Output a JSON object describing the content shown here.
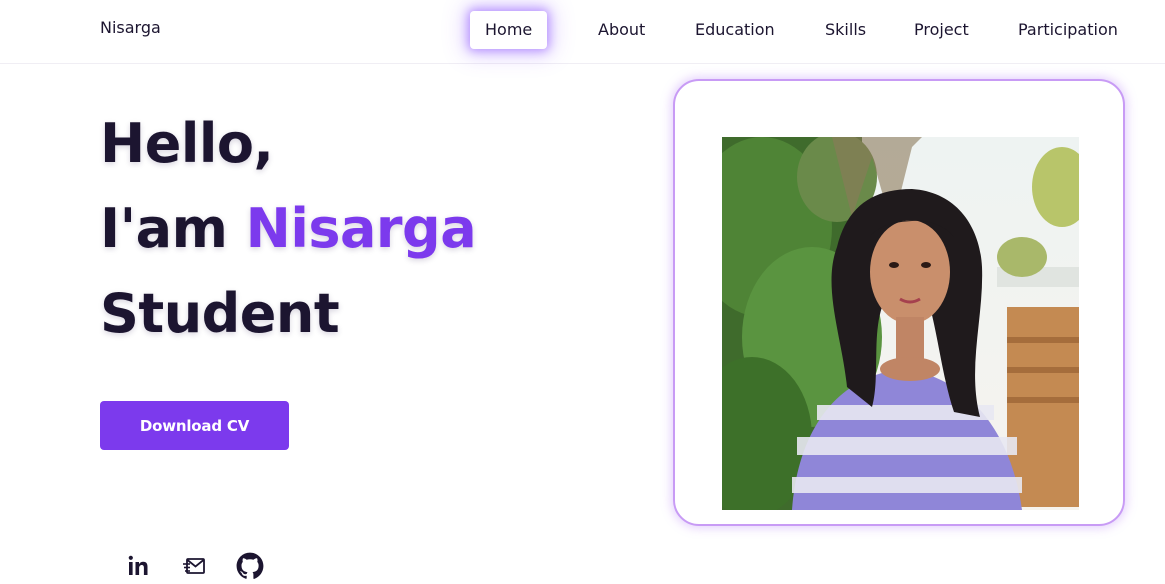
{
  "header": {
    "brand": "Nisarga",
    "nav": [
      {
        "label": "Home",
        "active": true
      },
      {
        "label": "About",
        "active": false
      },
      {
        "label": "Education",
        "active": false
      },
      {
        "label": "Skills",
        "active": false
      },
      {
        "label": "Project",
        "active": false
      },
      {
        "label": "Participation",
        "active": false
      }
    ]
  },
  "hero": {
    "greeting": "Hello,",
    "intro": "I'am ",
    "name": "Nisarga",
    "role": "Student",
    "cv_label": "Download CV"
  },
  "social": [
    {
      "icon": "linkedin-icon"
    },
    {
      "icon": "mail-icon"
    },
    {
      "icon": "github-icon"
    }
  ],
  "colors": {
    "accent": "#7c3aed",
    "text": "#1c1530",
    "card_border": "#c89bf5"
  }
}
